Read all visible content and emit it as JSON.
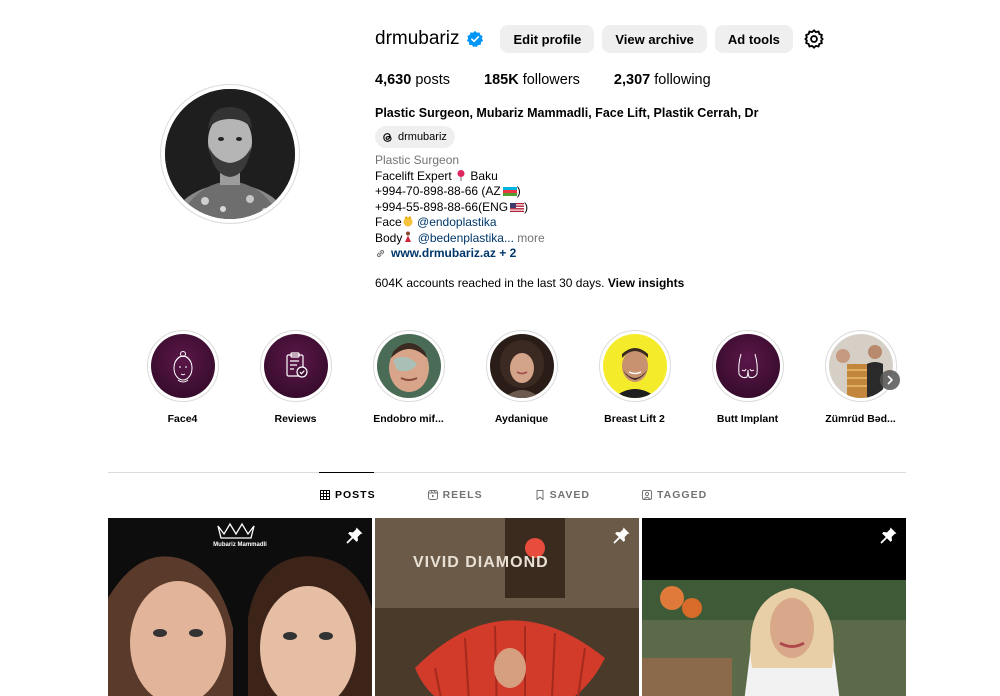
{
  "profile": {
    "username": "drmubariz",
    "buttons": {
      "edit": "Edit profile",
      "archive": "View archive",
      "ad_tools": "Ad tools"
    },
    "stats": {
      "posts_count": "4,630",
      "posts_label": "posts",
      "followers_count": "185K",
      "followers_label": "followers",
      "following_count": "2,307",
      "following_label": "following"
    },
    "full_name": "Plastic Surgeon, Mubariz Mammadli, Face Lift, Plastik Cerrah, Dr",
    "threads_handle": "drmubariz",
    "bio": {
      "category": "Plastic Surgeon",
      "line1": "Facelift Expert",
      "line1_place": "Baku",
      "line2": "+994-70-898-88-66 (AZ",
      "line2_end": ")",
      "line3": "+994-55-898-88-66(ENG",
      "line3_end": ")",
      "line4_prefix": "Face",
      "line4_mention": "@endoplastika",
      "line5_prefix": "Body",
      "line5_mention": "@bedenplastika...",
      "more": "more",
      "link": "www.drmubariz.az + 2"
    },
    "insights_text": "604K accounts reached in the last 30 days.",
    "insights_link": "View insights"
  },
  "highlights": [
    {
      "label": "Face4",
      "icon": "face-outline-icon"
    },
    {
      "label": "Reviews",
      "icon": "clipboard-check-icon"
    },
    {
      "label": "Endobro mif...",
      "icon": "photo"
    },
    {
      "label": "Aydanique",
      "icon": "photo"
    },
    {
      "label": "Breast Lift 2",
      "icon": "photo"
    },
    {
      "label": "Butt Implant",
      "icon": "body-outline-icon"
    },
    {
      "label": "Zümrüd Bəd...",
      "icon": "photo"
    }
  ],
  "tabs": [
    {
      "label": "POSTS",
      "active": true
    },
    {
      "label": "REELS",
      "active": false
    },
    {
      "label": "SAVED",
      "active": false
    },
    {
      "label": "TAGGED",
      "active": false
    }
  ],
  "posts": [
    {
      "overlay_text": "Mubariz Mammadli",
      "pinned": true
    },
    {
      "overlay_text": "VIVID DIAMOND",
      "pinned": true
    },
    {
      "pinned": true
    }
  ],
  "colors": {
    "verified": "#0095f6",
    "link": "#00376b",
    "button_bg": "#efefef",
    "highlight_bg": "#3d0d32"
  }
}
